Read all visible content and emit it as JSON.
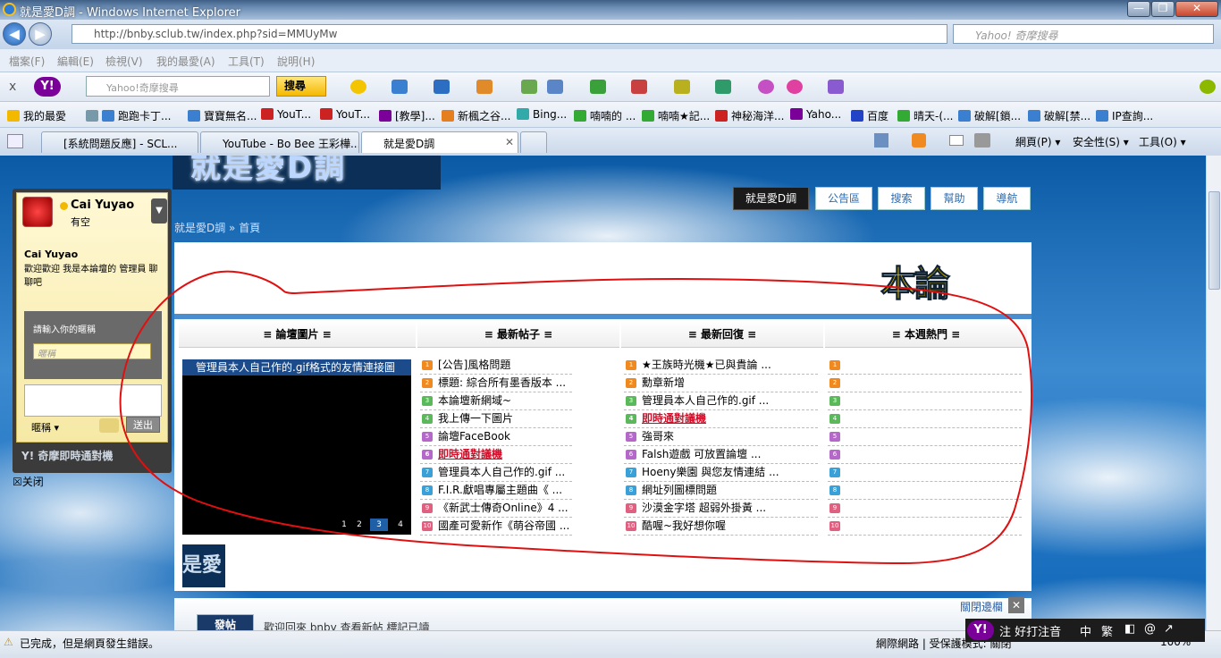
{
  "window": {
    "title": "就是愛D調 - Windows Internet Explorer",
    "min": "—",
    "max": "❐",
    "close": "✕"
  },
  "address": {
    "url": "http://bnby.sclub.tw/index.php?sid=MMUyMw",
    "search_placeholder": "Yahoo! 奇摩搜尋",
    "back": "◀",
    "forward": "▶"
  },
  "menu": [
    "檔案(F)",
    "編輯(E)",
    "檢視(V)",
    "我的最愛(A)",
    "工具(T)",
    "說明(H)"
  ],
  "ytoolbar": {
    "close": "x",
    "logo": "Y!",
    "search_placeholder": "Yahoo!奇摩搜尋",
    "search_btn": "搜尋"
  },
  "favorites": {
    "label": "我的最愛",
    "items": [
      "跑跑卡丁...",
      "寶寶無名...",
      "YouT...",
      "YouT...",
      "[教學]...",
      "新楓之谷...",
      "Bing...",
      "喃喃的 ...",
      "喃喃★記...",
      "神秘海洋...",
      "Yaho...",
      "百度",
      "晴天-(...",
      "破解[鎖...",
      "破解[禁...",
      "IP查詢..."
    ]
  },
  "tabs": [
    "[系統問題反應] - SCL...",
    "YouTube - Bo Bee 王彩樺...",
    "就是愛D調"
  ],
  "commands": [
    "網頁(P) ▾",
    "安全性(S) ▾",
    "工具(O) ▾"
  ],
  "page": {
    "banner": "就是愛D調",
    "nav": [
      "就是愛D調",
      "公告區",
      "搜索",
      "幫助",
      "導航"
    ],
    "breadcrumb": "就是愛D調 » 首頁",
    "logo": "本論",
    "columns": [
      "≡ 論壇圖片 ≡",
      "≡ 最新帖子 ≡",
      "≡ 最新回復 ≡",
      "≡ 本週熱門 ≡"
    ],
    "slide_caption": "管理員本人自己作的.gif格式的友情連接圖",
    "slide_pages": [
      "1",
      "2",
      "3",
      "4"
    ],
    "thumb": "是愛",
    "latest_posts": [
      "[公告]風格問題",
      "標題: 綜合所有墨香版本 ...",
      "本論壇新網域~",
      "我上傳一下圖片",
      "論壇FaceBook",
      "即時通對議機",
      "管理員本人自己作的.gif ...",
      "F.I.R.獻唱專屬主題曲《 ...",
      "《新武士傳奇Online》4 ...",
      "國產可愛新作《萌谷帝國 ..."
    ],
    "latest_replies": [
      "★王族時光機★已與貴論 ...",
      "勳章新增",
      "管理員本人自己作的.gif ...",
      "即時通對議機",
      "強哥來",
      "Falsh遊戲 可放置論壇 ...",
      "Hoeny樂園 與您友情連結 ...",
      "網址列圖標問題",
      "沙漠金字塔 超弱外掛黃 ...",
      "酷喔~我好想你喔"
    ],
    "hot_badges": [
      "1",
      "2",
      "3",
      "4",
      "5",
      "6",
      "7",
      "8",
      "9",
      "10"
    ],
    "post_btn": "發帖",
    "welcome": "歡迎回來 bnby  查看新帖  標記已讀",
    "close_bar": "關閉邊欄",
    "close_x": "✕"
  },
  "chat": {
    "name": "Cai Yuyao",
    "status": "有空",
    "name2": "Cai Yuyao",
    "message": "歡迎歡迎 我是本論壇的 管理員 聊聊吧",
    "nick_label": "請輸入你的暱稱",
    "nick_placeholder": "暱稱",
    "nick_dd": "暱稱 ▾",
    "send": "送出",
    "yahoo": "Y! 奇摩即時通對機",
    "close": "☒关闭"
  },
  "ime": {
    "text": "注 好打注音",
    "mode1": "中",
    "mode2": "繁"
  },
  "status": {
    "text": "已完成，但是網頁發生錯誤。",
    "zone": "網際網路 | 受保護模式: 關閉",
    "zoom": "100%"
  },
  "colors": {
    "accent": "#1f5fa8",
    "hot": "#d0102a",
    "annotation": "#e01010"
  }
}
